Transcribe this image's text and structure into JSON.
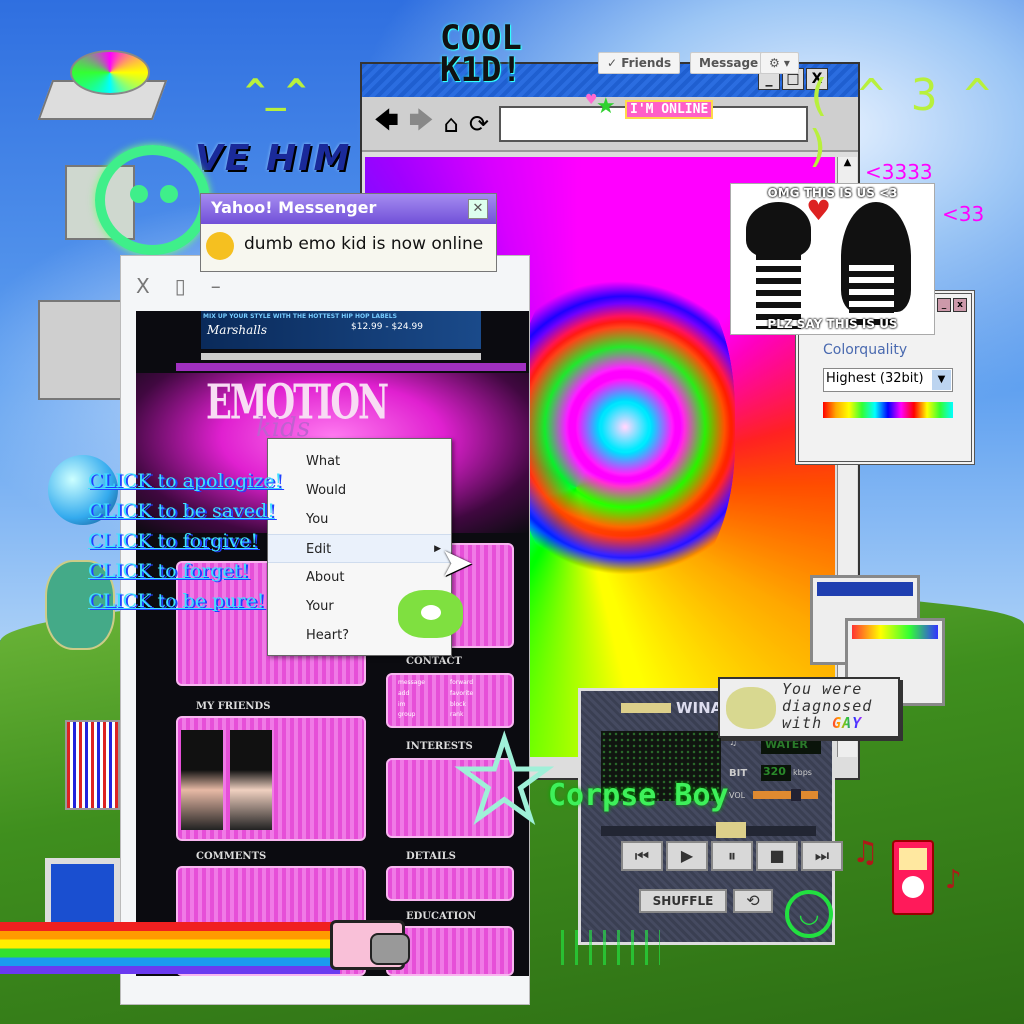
{
  "colors": {
    "sky": "#3a7fe0",
    "grass": "#3f8f1e",
    "accent_pink": "#ff5fc8",
    "accent_green": "#3ef05a",
    "link_cyan": "#3fe0ff"
  },
  "desktop_icons": [
    "cd-drive-icon",
    "recycle-bin-icon",
    "computer-icon",
    "globe-icon",
    "network-icon",
    "window-icon",
    "monitor-icon"
  ],
  "stickers": {
    "cool_kid_line1": "COOL",
    "cool_kid_line2": "K1D!",
    "kaomoji_smile": "^_^",
    "kaomoji_kiss": "( ^ 3 ^ )",
    "love_him": "VE HIM",
    "hearts1": "<3333",
    "hearts2": "<33",
    "corpse_boy": "Corpse Boy"
  },
  "browser": {
    "friends_label": "✓ Friends",
    "message_label": "Message",
    "settings_label": "⚙ ▾",
    "online_badge": "I'M ONLINE",
    "window_buttons": [
      "_",
      "□",
      "X"
    ]
  },
  "emo_image": {
    "top_caption": "OMG THIS IS US <3",
    "bottom_caption": "PLZ SAY THIS IS US"
  },
  "color_dialog": {
    "label": "Colorquality",
    "selected": "Highest (32bit)"
  },
  "yahoo": {
    "title": "Yahoo! Messenger",
    "message": "dumb emo kid is now online"
  },
  "profile": {
    "window_buttons": [
      "X",
      "▯",
      "–"
    ],
    "banner_ad": "MIX UP YOUR STYLE WITH THE HOTTEST HIP HOP LABELS",
    "banner_brand": "Marshalls",
    "banner_price": "$12.99 - $24.99",
    "logo_main": "EMOTION",
    "logo_sub": "kids",
    "sections": {
      "contact": "CONTACT",
      "my_friends": "MY FRIENDS",
      "interests": "INTERESTS",
      "comments": "COMMENTS",
      "details": "DETAILS",
      "education": "EDUCATION"
    },
    "contact_items": [
      "message",
      "add",
      "im",
      "group",
      "forward",
      "favorite",
      "block",
      "rank"
    ]
  },
  "context_menu": {
    "items": [
      {
        "label": "What"
      },
      {
        "label": "Would"
      },
      {
        "label": "You"
      },
      {
        "label": "Edit",
        "submenu": true
      },
      {
        "label": "About"
      },
      {
        "label": "Your"
      },
      {
        "label": "Heart?"
      }
    ]
  },
  "links": [
    "CLICK to apologize!",
    "CLICK to be saved!",
    "CLICK to forgive!",
    "CLICK to forget!",
    "CLICK to be pure!"
  ],
  "winamp": {
    "title": "WINAMP",
    "song": "WATER",
    "kbps": "320",
    "kbps_unit": "kbps",
    "vol_label": "VOL",
    "bitrate_label": "BIT",
    "shuffle_label": "SHUFFLE",
    "controls": [
      "prev",
      "play",
      "pause",
      "stop",
      "next"
    ],
    "repeat_label": "⟲"
  },
  "diagnosis": {
    "line1": "You were",
    "line2": "diagnosed",
    "line3": "with",
    "highlight": "GAY"
  }
}
